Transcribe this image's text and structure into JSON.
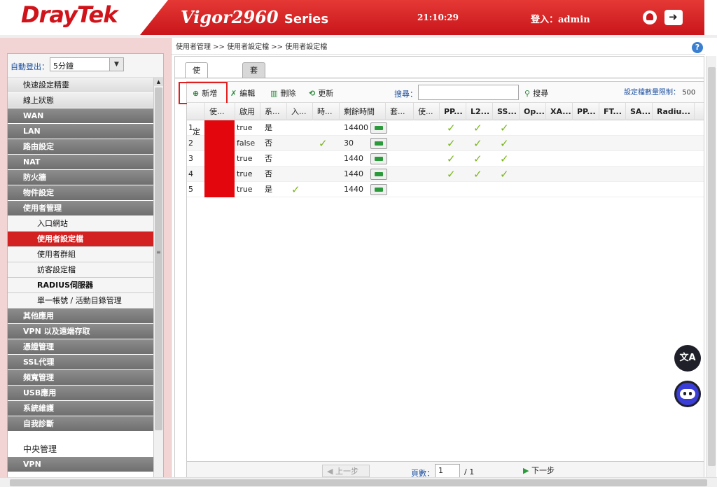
{
  "header": {
    "logo": "DrayTek",
    "product": "Vigor2960",
    "series": "Series",
    "clock": "21:10:29",
    "login": "登入：admin"
  },
  "sidebar": {
    "autologout_label": "自動登出：",
    "autologout_value": "5分鐘",
    "items": [
      {
        "label": "快速設定精靈",
        "style": "light"
      },
      {
        "label": "線上狀態",
        "style": "light"
      },
      {
        "label": "WAN",
        "style": "dark"
      },
      {
        "label": "LAN",
        "style": "dark"
      },
      {
        "label": "路由設定",
        "style": "dark"
      },
      {
        "label": "NAT",
        "style": "dark"
      },
      {
        "label": "防火牆",
        "style": "dark"
      },
      {
        "label": "物件設定",
        "style": "dark"
      },
      {
        "label": "使用者管理",
        "style": "dark"
      },
      {
        "label": "入口網站",
        "style": "sub"
      },
      {
        "label": "使用者設定檔",
        "style": "sub active"
      },
      {
        "label": "使用者群組",
        "style": "sub"
      },
      {
        "label": "訪客設定檔",
        "style": "sub"
      },
      {
        "label": "RADIUS伺服器",
        "style": "sub bold"
      },
      {
        "label": "單一帳號 / 活動目錄管理",
        "style": "sub"
      },
      {
        "label": "其他應用",
        "style": "dark"
      },
      {
        "label": "VPN 以及遠端存取",
        "style": "dark"
      },
      {
        "label": "憑證管理",
        "style": "dark"
      },
      {
        "label": "SSL代理",
        "style": "dark"
      },
      {
        "label": "頻寬管理",
        "style": "dark"
      },
      {
        "label": "USB應用",
        "style": "dark"
      },
      {
        "label": "系統維護",
        "style": "dark"
      },
      {
        "label": "自我診斷",
        "style": "dark"
      },
      {
        "label": "中央管理",
        "style": "white"
      },
      {
        "label": "VPN",
        "style": "dark"
      }
    ]
  },
  "main": {
    "breadcrumb": "使用者管理 >> 使用者設定檔 >> 使用者設定檔",
    "help": "?",
    "tabs": [
      "使用者設定檔",
      "套用全部"
    ],
    "toolbar": {
      "add": "新增",
      "edit": "編輯",
      "delete": "刪除",
      "refresh": "更新",
      "search_label": "搜尋：",
      "search_button": "搜尋",
      "quota_label": "設定檔數量限制：",
      "quota_value": "500"
    },
    "columns": [
      "使...",
      "啟用",
      "系...",
      "入...",
      "時...",
      "剩餘時間",
      "套...",
      "使...",
      "PP...",
      "L2...",
      "SS...",
      "Op...",
      "XA...",
      "PP...",
      "FT...",
      "SA...",
      "Radiu..."
    ],
    "rows": [
      {
        "idx": "1",
        "enable": "true",
        "sys": "是",
        "remain": "14400"
      },
      {
        "idx": "2",
        "enable": "false",
        "sys": "否",
        "remain": "30"
      },
      {
        "idx": "3",
        "enable": "true",
        "sys": "否",
        "remain": "1440"
      },
      {
        "idx": "4",
        "enable": "true",
        "sys": "否",
        "remain": "1440"
      },
      {
        "idx": "5",
        "enable": "true",
        "sys": "是",
        "remain": "1440"
      }
    ],
    "pager": {
      "prev": "上一步",
      "page_label": "頁數：",
      "page_value": "1",
      "total": "/ 1",
      "next": "下一步"
    }
  }
}
